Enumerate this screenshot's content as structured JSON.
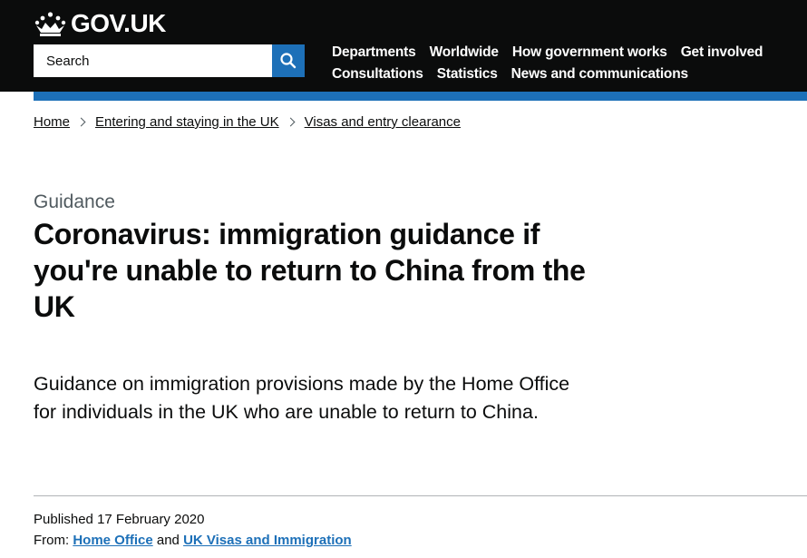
{
  "header": {
    "logo_text": "GOV.UK",
    "search": {
      "placeholder": "Search",
      "value": ""
    },
    "nav_row1": [
      "Departments",
      "Worldwide",
      "How government works",
      "Get involved"
    ],
    "nav_row2": [
      "Consultations",
      "Statistics",
      "News and communications"
    ]
  },
  "breadcrumbs": [
    "Home",
    "Entering and staying in the UK",
    "Visas and entry clearance"
  ],
  "page": {
    "caption": "Guidance",
    "title": "Coronavirus: immigration guidance if you're unable to return to China from the UK",
    "lead": "Guidance on immigration provisions made by the Home Office for individuals in the UK who are unable to return to China."
  },
  "meta": {
    "published_label": "Published",
    "published_date": "17 February 2020",
    "from_label": "From:",
    "org1": "Home Office",
    "and": "and",
    "org2": "UK Visas and Immigration"
  },
  "colors": {
    "header_bg": "#0b0c0c",
    "brand_blue": "#1d70b8",
    "caption_grey": "#505a5f"
  }
}
